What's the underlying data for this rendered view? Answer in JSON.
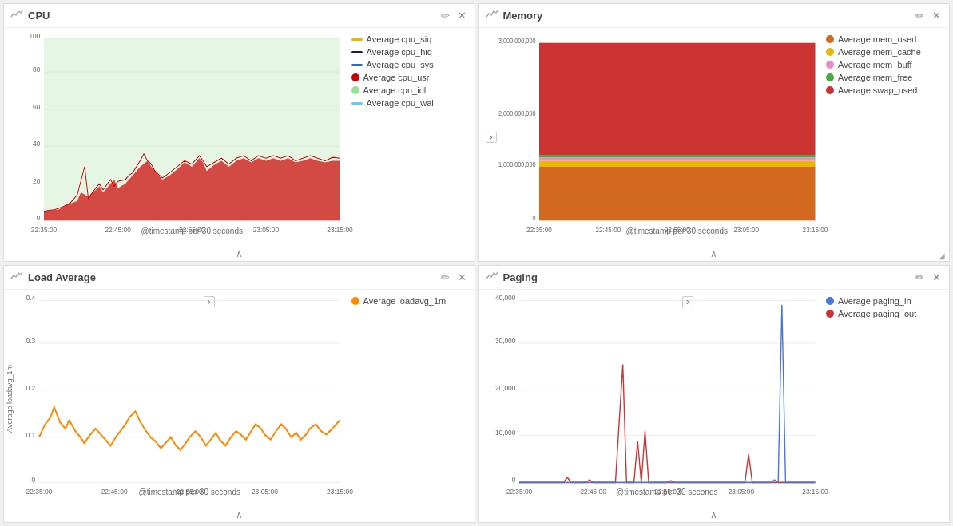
{
  "panels": [
    {
      "id": "cpu",
      "title": "CPU",
      "legend_items": [
        {
          "label": "Average cpu_siq",
          "color": "#e6b800",
          "type": "line"
        },
        {
          "label": "Average cpu_hiq",
          "color": "#1a1a4e",
          "type": "line"
        },
        {
          "label": "Average cpu_sys",
          "color": "#3366cc",
          "type": "line"
        },
        {
          "label": "Average cpu_usr",
          "color": "#cc0000",
          "type": "area"
        },
        {
          "label": "Average cpu_idl",
          "color": "#99dd99",
          "type": "area"
        },
        {
          "label": "Average cpu_wai",
          "color": "#66ccee",
          "type": "line"
        }
      ],
      "x_ticks": [
        "22:35:00",
        "22:45:00",
        "22:55:00",
        "23:05:00",
        "23:15:00"
      ],
      "x_label": "@timestamp per 30 seconds",
      "y_ticks": [
        "0",
        "20",
        "40",
        "60",
        "80",
        "100"
      ],
      "chart_type": "cpu"
    },
    {
      "id": "memory",
      "title": "Memory",
      "legend_items": [
        {
          "label": "Average mem_used",
          "color": "#d2691e",
          "type": "area"
        },
        {
          "label": "Average mem_cache",
          "color": "#e6b800",
          "type": "area"
        },
        {
          "label": "Average mem_buff",
          "color": "#ee88cc",
          "type": "area"
        },
        {
          "label": "Average mem_free",
          "color": "#44aa44",
          "type": "area"
        },
        {
          "label": "Average swap_used",
          "color": "#cc3333",
          "type": "area"
        }
      ],
      "x_ticks": [
        "22:35:00",
        "22:45:00",
        "22:55:00",
        "23:05:00",
        "23:15:00"
      ],
      "x_label": "@timestamp per 30 seconds",
      "y_ticks": [
        "0",
        "1,000,000,000",
        "2,000,000,000",
        "3,000,000,000"
      ],
      "chart_type": "memory"
    },
    {
      "id": "load-average",
      "title": "Load Average",
      "legend_items": [
        {
          "label": "Average loadavg_1m",
          "color": "#ff8800",
          "type": "line"
        }
      ],
      "x_ticks": [
        "22:35:00",
        "22:45:00",
        "22:55:00",
        "23:05:00",
        "23:15:00"
      ],
      "x_label": "@timestamp per 30 seconds",
      "y_ticks": [
        "0",
        "0.1",
        "0.2",
        "0.3",
        "0.4"
      ],
      "y_axis_label": "Average loadavg_1m",
      "chart_type": "load"
    },
    {
      "id": "paging",
      "title": "Paging",
      "legend_items": [
        {
          "label": "Average paging_in",
          "color": "#4477dd",
          "type": "line"
        },
        {
          "label": "Average paging_out",
          "color": "#cc3333",
          "type": "line"
        }
      ],
      "x_ticks": [
        "22:35:00",
        "22:45:00",
        "22:55:00",
        "23:05:00",
        "23:15:00"
      ],
      "x_label": "@timestamp per 30 seconds",
      "y_ticks": [
        "0",
        "10,000",
        "20,000",
        "30,000",
        "40,000"
      ],
      "chart_type": "paging"
    }
  ],
  "icons": {
    "chart": "📈",
    "edit": "✏",
    "close": "✕",
    "chevron_up": "∧",
    "expand": "›",
    "resize": "◢"
  }
}
